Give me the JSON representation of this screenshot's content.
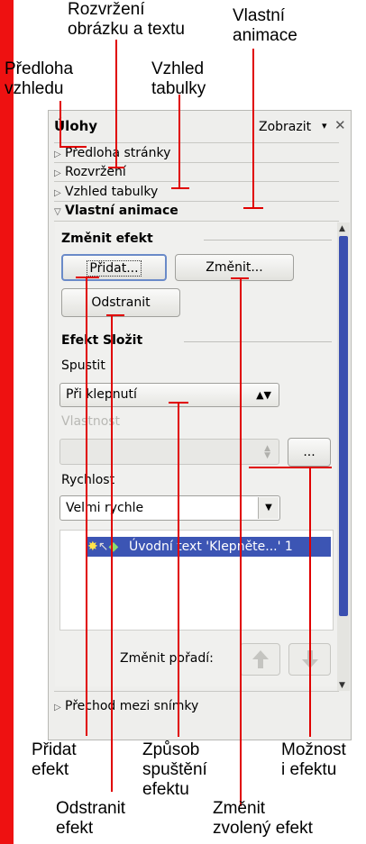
{
  "panel": {
    "title": "Úlohy",
    "view_label": "Zobrazit",
    "view_arrow": "▾",
    "close_glyph": "✕",
    "decks": [
      "Předloha stránky",
      "Rozvržení",
      "Vzhled tabulky",
      "Vlastní animace"
    ],
    "bottom_deck": "Přechod mezi snímky",
    "modify_section": "Změnit efekt",
    "add_button": "Přidat...",
    "change_button": "Změnit...",
    "remove_button": "Odstranit",
    "effect_section": "Efekt Složit",
    "start_label": "Spustit",
    "start_value": "Při klepnutí",
    "property_label": "Vlastnost",
    "options_button": "...",
    "speed_label": "Rychlost",
    "speed_value": "Velmi rychle",
    "effect_item": "Úvodní text 'Klepněte...' 1",
    "reorder_label": "Změnit pořadí:",
    "up_icon": "arrow-up-icon",
    "down_icon": "arrow-down-icon"
  },
  "callouts": {
    "layout_img_text": "Rozvržení\nobrázku a textu",
    "custom_animation": "Vlastní\nanimace",
    "master_pages": "Předloha\nvzhledu",
    "table_design": "Vzhled\ntabulky",
    "add_effect": "Přidat\nefekt",
    "start_method": "Způsob\nspuštění\nefektu",
    "effect_options": "Možnost\ni efektu",
    "remove_effect": "Odstranit\nefekt",
    "change_effect": "Změnit\nzvolený efekt"
  },
  "colors": {
    "accent_red": "#e00000",
    "scroll_thumb": "#3a4fb0",
    "selection": "#3c55b4"
  }
}
